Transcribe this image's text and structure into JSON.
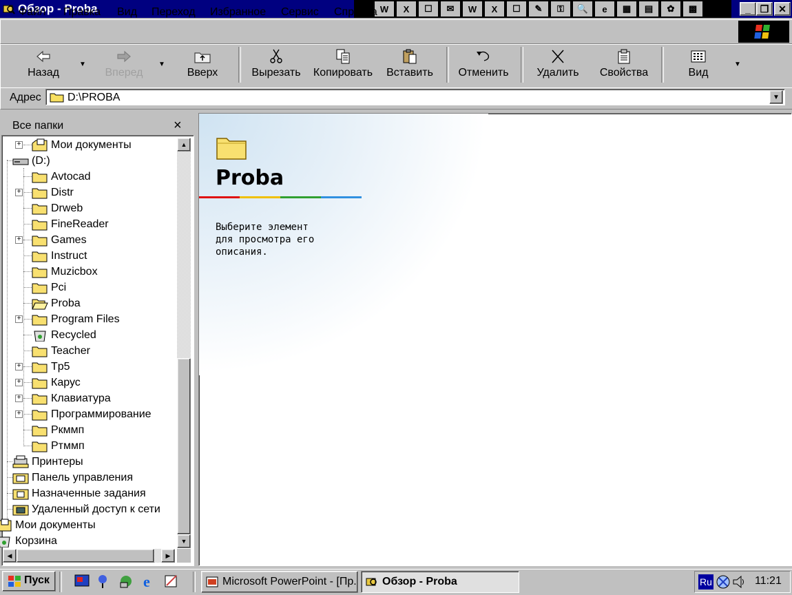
{
  "window": {
    "title": "Обзор - Proba",
    "buttons": {
      "minimize": "_",
      "maximize": "❐",
      "close": "✕"
    }
  },
  "office_bar": [
    "W",
    "X",
    "☐",
    "✉",
    "✎",
    "⚿",
    "🔍",
    "e",
    "▦",
    "▤",
    "✿",
    "▩"
  ],
  "menu": [
    "Файл",
    "Правка",
    "Вид",
    "Переход",
    "Избранное",
    "Сервис",
    "Справка"
  ],
  "toolbar": {
    "back": "Назад",
    "forward": "Вперед",
    "up": "Вверх",
    "cut": "Вырезать",
    "copy": "Копировать",
    "paste": "Вставить",
    "undo": "Отменить",
    "delete": "Удалить",
    "properties": "Свойства",
    "view": "Вид"
  },
  "address": {
    "label": "Адрес",
    "value": "D:\\PROBA"
  },
  "folders_pane": {
    "title": "Все папки",
    "close": "×",
    "items": [
      {
        "label": "Мои документы",
        "icon": "my-documents-icon"
      },
      {
        "label": "(D:)",
        "icon": "drive-icon"
      },
      {
        "label": "Avtocad",
        "icon": "folder-icon"
      },
      {
        "label": "Distr",
        "icon": "folder-icon"
      },
      {
        "label": "Drweb",
        "icon": "folder-icon"
      },
      {
        "label": "FineReader",
        "icon": "folder-icon"
      },
      {
        "label": "Games",
        "icon": "folder-icon"
      },
      {
        "label": "Instruct",
        "icon": "folder-icon"
      },
      {
        "label": "Muzicbox",
        "icon": "folder-icon"
      },
      {
        "label": "Pci",
        "icon": "folder-icon"
      },
      {
        "label": "Proba",
        "icon": "open-folder-icon"
      },
      {
        "label": "Program Files",
        "icon": "folder-icon"
      },
      {
        "label": "Recycled",
        "icon": "recycle-bin-icon"
      },
      {
        "label": "Teacher",
        "icon": "folder-icon"
      },
      {
        "label": "Tp5",
        "icon": "folder-icon"
      },
      {
        "label": "Карус",
        "icon": "folder-icon"
      },
      {
        "label": "Клавиатура",
        "icon": "folder-icon"
      },
      {
        "label": "Программирование",
        "icon": "folder-icon"
      },
      {
        "label": "Ркммп",
        "icon": "folder-icon"
      },
      {
        "label": "Ртммп",
        "icon": "folder-icon"
      },
      {
        "label": "Принтеры",
        "icon": "printers-icon"
      },
      {
        "label": "Панель управления",
        "icon": "control-panel-icon"
      },
      {
        "label": "Назначенные задания",
        "icon": "scheduled-tasks-icon"
      },
      {
        "label": "Удаленный доступ к сети",
        "icon": "dial-up-networking-icon"
      },
      {
        "label": "Мои документы",
        "icon": "my-documents-icon"
      },
      {
        "label": "Корзина",
        "icon": "recycle-bin-icon"
      }
    ]
  },
  "content": {
    "folder_name": "Proba",
    "description": "Выберите элемент\nдля просмотра его\nописания."
  },
  "taskbar": {
    "start": "Пуск",
    "tasks": [
      "Microsoft PowerPoint - [Пр...",
      "Обзор - Proba"
    ],
    "lang": "Ru",
    "clock": "11:21"
  }
}
